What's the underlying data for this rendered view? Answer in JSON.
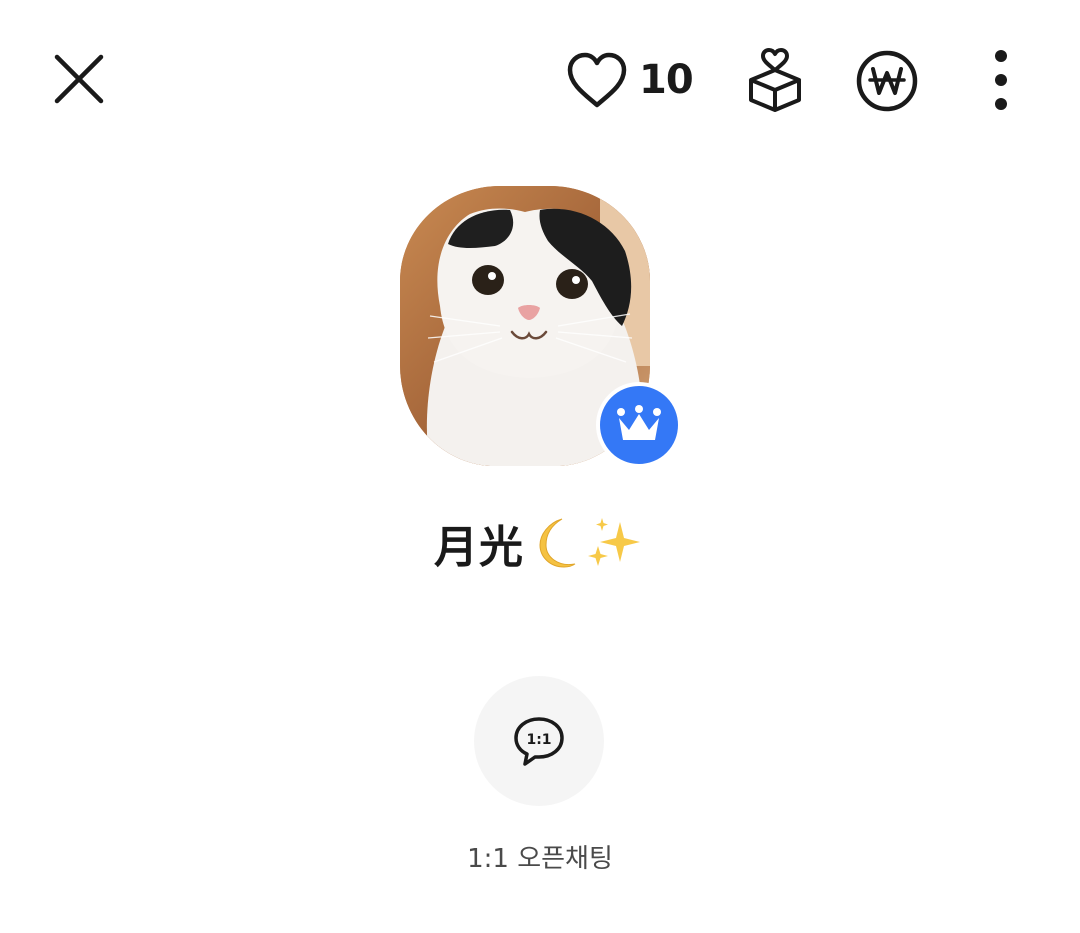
{
  "header": {
    "close_icon": "close-icon",
    "like_icon": "heart-outline-icon",
    "like_count": "10",
    "gift_icon": "gift-box-icon",
    "payment_icon": "won-currency-icon",
    "more_icon": "more-vertical-icon"
  },
  "profile": {
    "avatar_description_icon": "avatar-image",
    "badge_icon": "crown-icon",
    "badge_color": "#3478f6",
    "name": "月光",
    "name_emojis": [
      "crescent-moon-emoji",
      "sparkles-emoji"
    ]
  },
  "actions": {
    "open_chat_icon": "chat-bubble-1to1-icon",
    "open_chat_icon_text": "1:1",
    "open_chat_label": "1:1 오픈채팅"
  },
  "colors": {
    "background": "#ffffff",
    "text_primary": "#1a1a1a",
    "text_secondary": "#4a4a4a",
    "action_circle": "#f5f5f5",
    "accent_blue": "#3478f6"
  }
}
